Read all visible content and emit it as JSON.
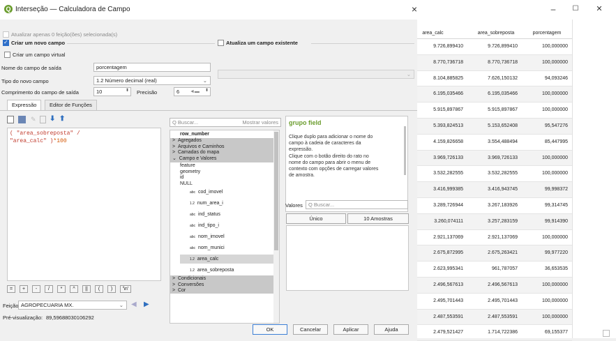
{
  "window": {
    "title": "Interseção — Calculadora de Campo",
    "close": "×",
    "right_min": "–",
    "right_max": "☐",
    "right_close": "✕"
  },
  "top": {
    "only_selected": "Atualizar apenas 0 feição(ões) selecionada(s)",
    "create_new": "Criar um novo campo",
    "update_existing": "Atualiza um campo existente",
    "virtual": "Criar um campo virtual",
    "field_name_label": "Nome do campo de saída",
    "field_name_value": "porcentagem",
    "type_label": "Tipo do novo campo",
    "type_value": "1.2  Número decimal (real)",
    "length_label": "Comprimento do campo de saída",
    "length_value": "10",
    "precision_label": "Precisão",
    "precision_value": "6"
  },
  "tabs": [
    "Expressão",
    "Editor de Funções"
  ],
  "expression": {
    "line1": "( \"area_sobreposta\" /",
    "line2a": "\"area_calc\" )",
    "line2b": "*100"
  },
  "operators": [
    "=",
    "+",
    "-",
    "/",
    "*",
    "^",
    "||",
    "(",
    ")",
    "'\\n'"
  ],
  "feature": {
    "label": "Feição",
    "value": "AGROPECUARIA MX."
  },
  "preview": {
    "label": "Pré-visualização:",
    "value": "89,59688030106292"
  },
  "search": {
    "placeholder": "Q  Buscar...",
    "show_values": "Mostrar valores"
  },
  "tree": {
    "row_number": "row_number",
    "groups_top": [
      "Agregados",
      "Arquivos e Caminhos",
      "Camadas do mapa",
      "Campo e Valores"
    ],
    "plain": [
      "feature",
      "geometry",
      "id",
      "NULL"
    ],
    "fields": [
      {
        "type": "abc",
        "name": "cod_imovel"
      },
      {
        "type": "1.2",
        "name": "num_area_i"
      },
      {
        "type": "abc",
        "name": "ind_status"
      },
      {
        "type": "abc",
        "name": "ind_tipo_i"
      },
      {
        "type": "abc",
        "name": "nom_imovel"
      },
      {
        "type": "abc",
        "name": "nom_munici"
      },
      {
        "type": "1.2",
        "name": "area_calc"
      },
      {
        "type": "1.2",
        "name": "area_sobreposta"
      }
    ],
    "groups_bottom": [
      "Condicionais",
      "Conversões",
      "Cor"
    ]
  },
  "help": {
    "title": "grupo field",
    "text": [
      "Clique duplo para adicionar o nome do",
      "campo à cadeia de caracteres da",
      "expressão.",
      "Clique com o botão direito do rato no",
      "nome do campo para abrir o menu de",
      "contexto com opções de carregar valores",
      "de amostra."
    ]
  },
  "values": {
    "label": "Valores",
    "search": "Q  Buscar...",
    "unique": "Único",
    "samples": "10 Amostras"
  },
  "buttons": {
    "ok": "OK",
    "cancel": "Cancelar",
    "apply": "Aplicar",
    "help": "Ajuda"
  },
  "table": {
    "headers": [
      "area_calc",
      "area_sobreposta",
      "porcentagem"
    ],
    "rows": [
      [
        "9.726,899410",
        "9.726,899410",
        "100,000000"
      ],
      [
        "8.770,736718",
        "8.770,736718",
        "100,000000"
      ],
      [
        "8.104,885825",
        "7.626,150132",
        "94,093246"
      ],
      [
        "6.195,035466",
        "6.195,035466",
        "100,000000"
      ],
      [
        "5.915,897867",
        "5.915,897867",
        "100,000000"
      ],
      [
        "5.393,824513",
        "5.153,652408",
        "95,547276"
      ],
      [
        "4.159,826658",
        "3.554,488494",
        "85,447995"
      ],
      [
        "3.969,726133",
        "3.969,726133",
        "100,000000"
      ],
      [
        "3.532,282555",
        "3.532,282555",
        "100,000000"
      ],
      [
        "3.416,999385",
        "3.416,943745",
        "99,998372"
      ],
      [
        "3.289,726944",
        "3.267,183926",
        "99,314745"
      ],
      [
        "3.260,074111",
        "3.257,283159",
        "99,914390"
      ],
      [
        "2.921,137069",
        "2.921,137069",
        "100,000000"
      ],
      [
        "2.675,872995",
        "2.675,263421",
        "99,977220"
      ],
      [
        "2.623,995341",
        "961,787057",
        "36,653535"
      ],
      [
        "2.496,567613",
        "2.496,567613",
        "100,000000"
      ],
      [
        "2.495,701443",
        "2.495,701443",
        "100,000000"
      ],
      [
        "2.487,553591",
        "2.487,553591",
        "100,000000"
      ],
      [
        "2.479,521427",
        "1.714,722386",
        "69,155377"
      ]
    ]
  }
}
